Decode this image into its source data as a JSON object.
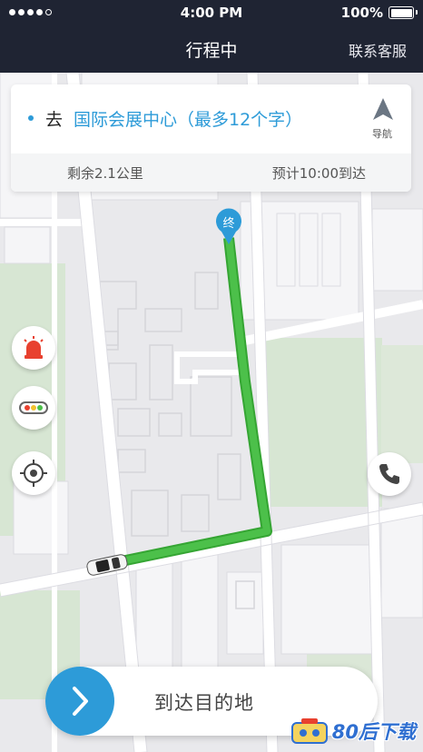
{
  "status_bar": {
    "time": "4:00 PM",
    "battery": "100%"
  },
  "nav": {
    "title": "行程中",
    "service_link": "联系客服"
  },
  "route_card": {
    "prefix": "去",
    "destination": "国际会展中心（最多12个字）",
    "navigate_label": "导航",
    "remaining": "剩余2.1公里",
    "eta": "预计10:00到达"
  },
  "map": {
    "end_marker_label": "终",
    "route_color": "#4cc04a"
  },
  "side_buttons": [
    "alarm-icon",
    "traffic-light-icon",
    "locate-icon"
  ],
  "call_button_icon": "phone-icon",
  "slider": {
    "label": "到达目的地"
  },
  "watermark": {
    "text": "80后下载"
  },
  "colors": {
    "accent": "#2d9bd8",
    "navbar": "#1f2433",
    "alarm": "#e8412f"
  }
}
